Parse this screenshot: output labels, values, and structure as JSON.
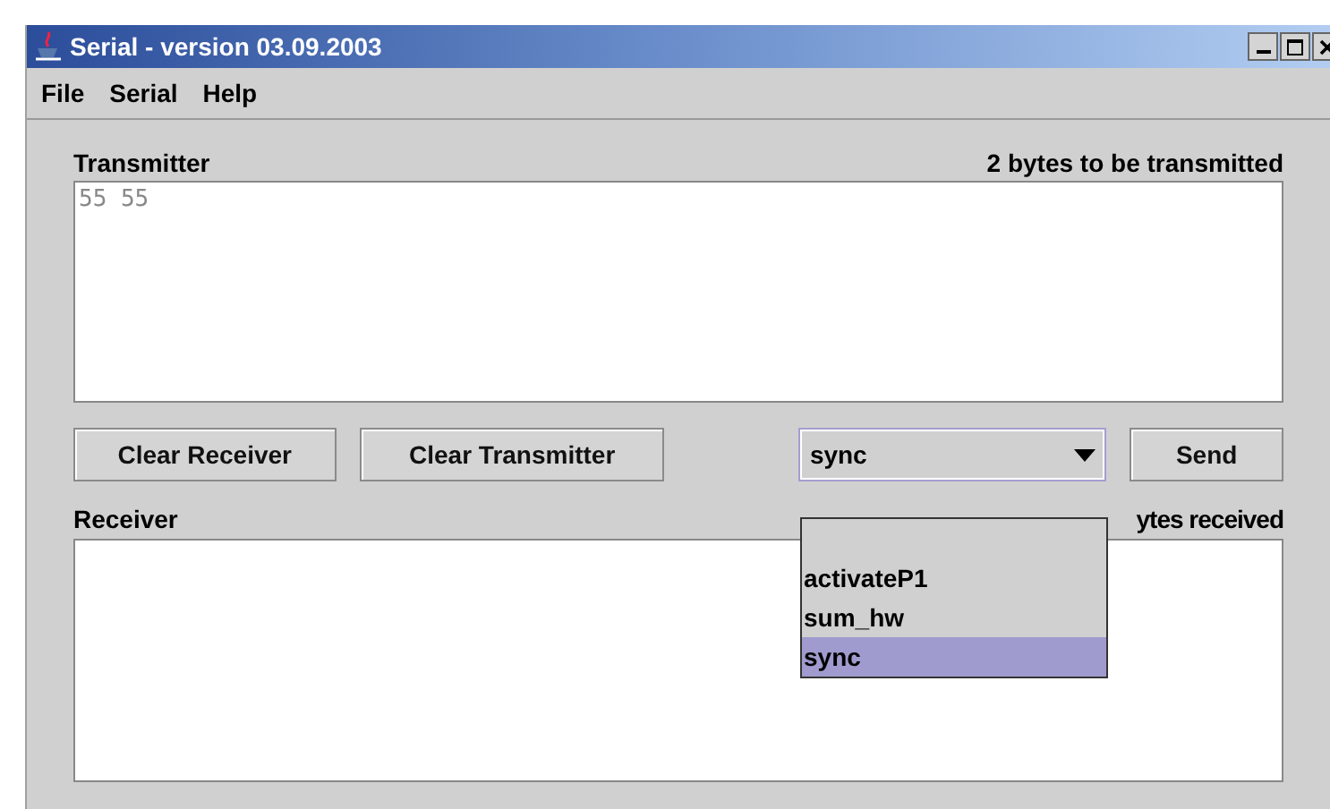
{
  "window": {
    "title": "Serial - version 03.09.2003"
  },
  "menu": [
    "File",
    "Serial",
    "Help"
  ],
  "transmitter": {
    "label": "Transmitter",
    "status": "2 bytes to be transmitted",
    "value": "55 55"
  },
  "buttons": {
    "clear_receiver": "Clear Receiver",
    "clear_transmitter": "Clear Transmitter",
    "send": "Send"
  },
  "command_combo": {
    "value": "sync",
    "expanded": true,
    "options": [
      {
        "selected": false
      },
      {
        "label": "activateP1",
        "selected": false
      },
      {
        "label": "sum_hw",
        "selected": false
      },
      {
        "label": "sync",
        "selected": true
      }
    ]
  },
  "receiver": {
    "label": "Receiver",
    "status": "ytes received"
  }
}
